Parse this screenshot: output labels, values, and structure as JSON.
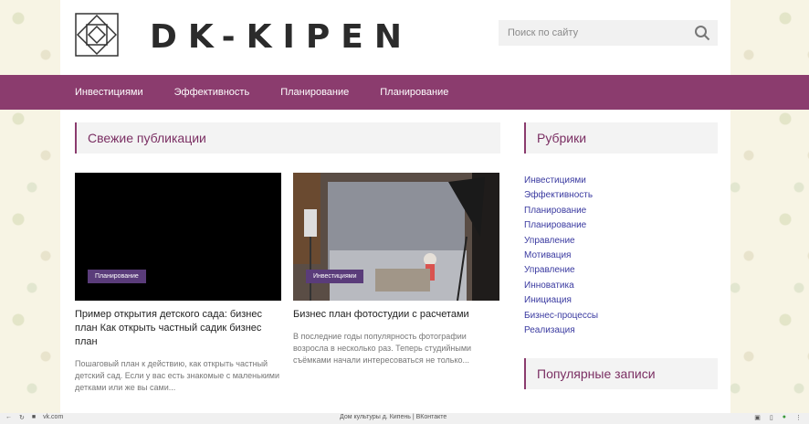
{
  "top_notice": "",
  "header": {
    "logo_text": "DK-KIPEN",
    "search_placeholder": "Поиск по сайту"
  },
  "nav": {
    "items": [
      "Инвестициями",
      "Эффективность",
      "Планирование",
      "Планирование"
    ]
  },
  "main": {
    "section_title": "Свежие публикации",
    "cards": [
      {
        "badge": "Планирование",
        "title": "Пример открытия детского сада: бизнес план Как открыть частный садик бизнес план",
        "desc": "Пошаговый план к действию, как открыть частный детский сад. Если у вас есть знакомые с маленькими детками или же вы сами..."
      },
      {
        "badge": "Инвестициями",
        "title": "Бизнес план фотостудии с расчетами",
        "desc": "В последние годы популярность фотографии возросла в несколько раз. Теперь студийными съёмками начали интересоваться не только..."
      }
    ]
  },
  "sidebar": {
    "rubrics_title": "Рубрики",
    "rubrics": [
      "Инвестициями",
      "Эффективность",
      "Планирование",
      "Планирование",
      "Управление",
      "Мотивация",
      "Управление",
      "Инноватика",
      "Инициация",
      "Бизнес-процессы",
      "Реализация"
    ],
    "popular_title": "Популярные записи"
  },
  "statusbar": {
    "url": "vk.com",
    "center_text": "Дом культуры д. Кипень | ВКонтакте"
  },
  "colors": {
    "accent": "#8b3c6e",
    "badge": "#5a3c7a",
    "link": "#3a3aa0"
  }
}
